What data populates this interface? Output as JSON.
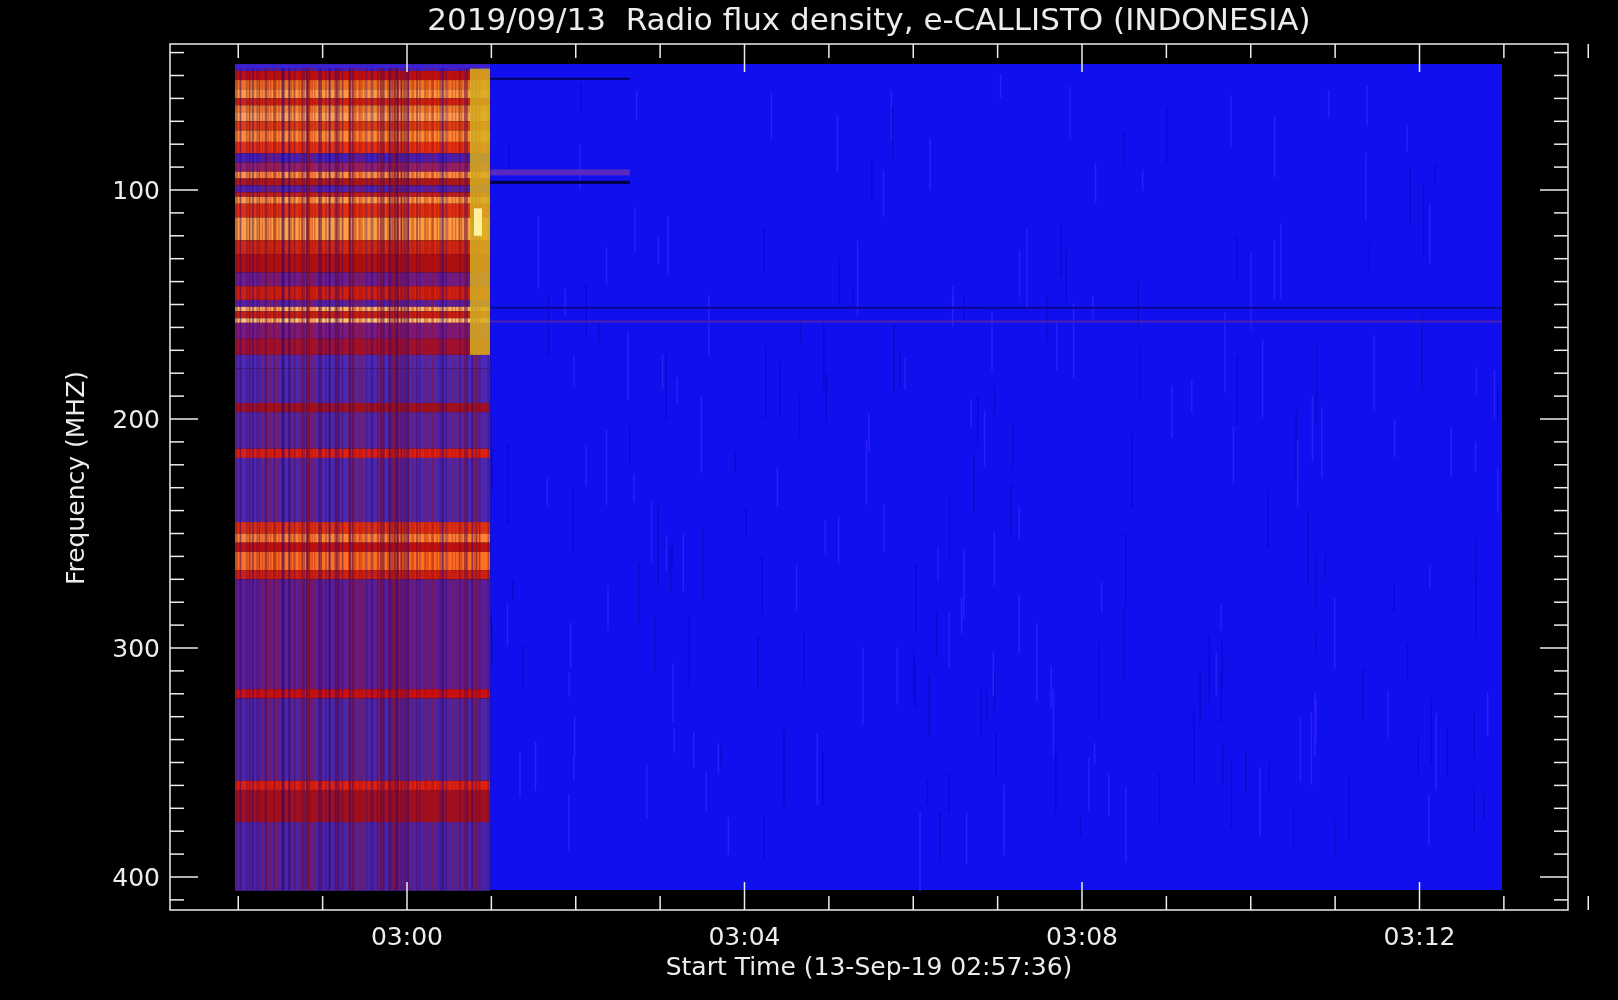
{
  "title": "2019/09/13  Radio flux density, e-CALLISTO (INDONESIA)",
  "y_axis": {
    "label": "Frequency (MHZ)",
    "ticks": [
      "100",
      "200",
      "300",
      "400"
    ]
  },
  "x_axis": {
    "label": "Start Time (13-Sep-19 02:57:36)",
    "ticks": [
      "03:00",
      "03:04",
      "03:08",
      "03:12"
    ]
  }
}
